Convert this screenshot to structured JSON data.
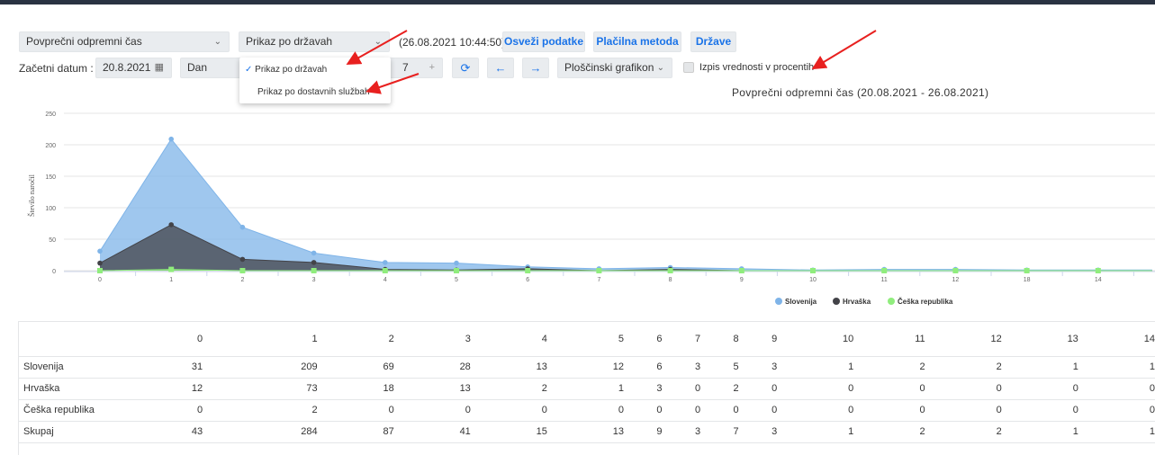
{
  "toolbar": {
    "metric_select": "Povprečni odpremni čas",
    "view_select": "Prikaz po državah",
    "timestamp": "(26.08.2021 10:44:50)",
    "refresh_label": "Osveži podatke",
    "payment_label": "Plačilna metoda",
    "countries_label": "Države",
    "start_date_label": "Začetni datum :",
    "start_date_value": "20.8.2021",
    "period_select": "Dan",
    "count_value": "7",
    "chart_type_select": "Ploščinski grafikon",
    "percent_label": "Izpis vrednosti v procentih"
  },
  "dropdown": {
    "options": [
      "Prikaz po državah",
      "Prikaz po dostavnih službah"
    ]
  },
  "colors": {
    "slovenia": "#7fb4e8",
    "croatia": "#434348",
    "czech": "#90ed7d",
    "accent": "#1a73e8",
    "arrow": "#e8201f"
  },
  "chart_data": {
    "type": "area",
    "title": "Povprečni odpremni čas (20.08.2021 - 26.08.2021)",
    "ylabel": "Število naročil",
    "xlabel": "",
    "ylim": [
      0,
      250
    ],
    "yticks": [
      0,
      50,
      100,
      150,
      200,
      250
    ],
    "categories": [
      "0",
      "1",
      "2",
      "3",
      "4",
      "5",
      "6",
      "7",
      "8",
      "9",
      "10",
      "11",
      "12",
      "18",
      "14"
    ],
    "series": [
      {
        "name": "Slovenija",
        "values": [
          31,
          209,
          69,
          28,
          13,
          12,
          6,
          3,
          5,
          3,
          1,
          2,
          2,
          1,
          1
        ]
      },
      {
        "name": "Hrvaška",
        "values": [
          12,
          73,
          18,
          13,
          2,
          1,
          3,
          0,
          2,
          0,
          0,
          0,
          0,
          0,
          0
        ]
      },
      {
        "name": "Češka republika",
        "values": [
          0,
          2,
          0,
          0,
          0,
          0,
          0,
          0,
          0,
          0,
          0,
          0,
          0,
          0,
          0
        ]
      }
    ],
    "legend": "bottom-right",
    "grid": true
  },
  "table": {
    "headers": [
      "0",
      "1",
      "2",
      "3",
      "4",
      "5",
      "6",
      "7",
      "8",
      "9",
      "10",
      "11",
      "12",
      "13",
      "14"
    ],
    "rows": [
      {
        "label": "Slovenija",
        "values": [
          "31",
          "209",
          "69",
          "28",
          "13",
          "12",
          "6",
          "3",
          "5",
          "3",
          "1",
          "2",
          "2",
          "1",
          "1"
        ]
      },
      {
        "label": "Hrvaška",
        "values": [
          "12",
          "73",
          "18",
          "13",
          "2",
          "1",
          "3",
          "0",
          "2",
          "0",
          "0",
          "0",
          "0",
          "0",
          "0"
        ]
      },
      {
        "label": "Češka republika",
        "values": [
          "0",
          "2",
          "0",
          "0",
          "0",
          "0",
          "0",
          "0",
          "0",
          "0",
          "0",
          "0",
          "0",
          "0",
          "0"
        ]
      },
      {
        "label": "Skupaj",
        "values": [
          "43",
          "284",
          "87",
          "41",
          "15",
          "13",
          "9",
          "3",
          "7",
          "3",
          "1",
          "2",
          "2",
          "1",
          "1"
        ]
      }
    ]
  }
}
